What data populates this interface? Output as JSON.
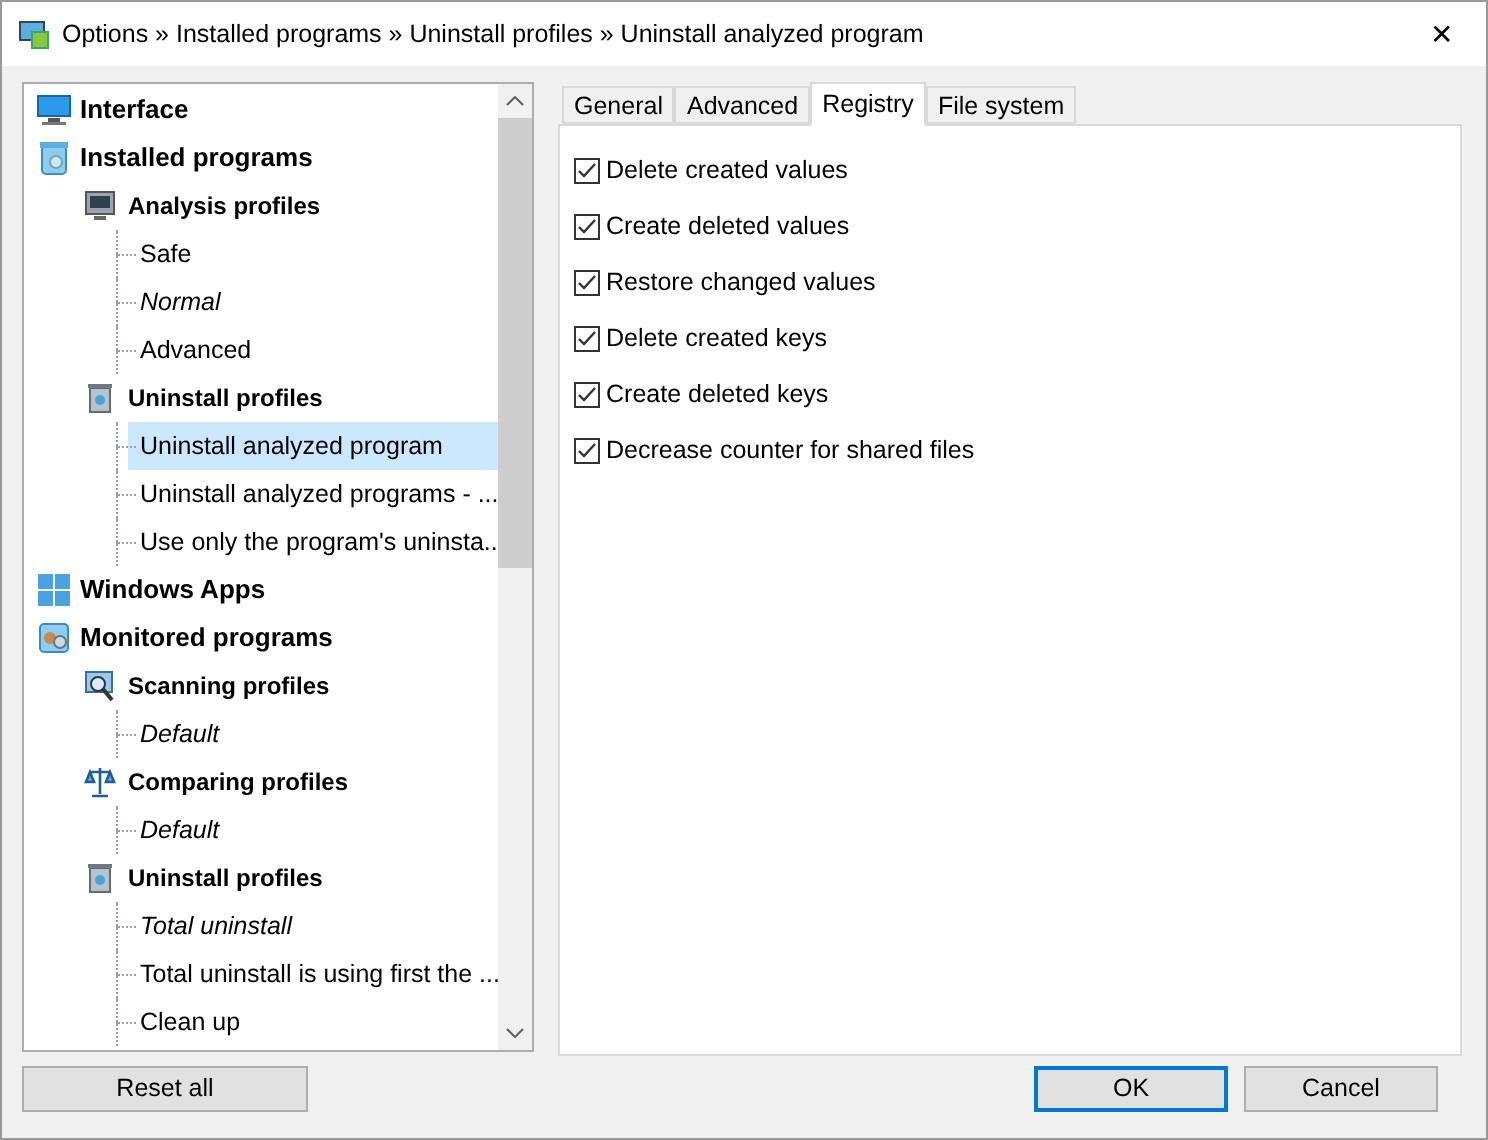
{
  "window": {
    "title": "Options » Installed programs » Uninstall profiles » Uninstall analyzed program",
    "close": "✕"
  },
  "tree": [
    {
      "label": "Interface",
      "kind": "monitor"
    },
    {
      "label": "Installed programs",
      "kind": "bin",
      "children": [
        {
          "label": "Analysis profiles",
          "kind": "screen",
          "children": [
            {
              "label": "Safe",
              "italic": false,
              "selected": false
            },
            {
              "label": "Normal",
              "italic": true,
              "selected": false
            },
            {
              "label": "Advanced",
              "italic": false,
              "selected": false
            }
          ]
        },
        {
          "label": "Uninstall profiles",
          "kind": "trash",
          "children": [
            {
              "label": "Uninstall analyzed program",
              "italic": false,
              "selected": true
            },
            {
              "label": "Uninstall analyzed programs - ...",
              "italic": false,
              "selected": false
            },
            {
              "label": "Use only the program's uninsta...",
              "italic": false,
              "selected": false
            }
          ]
        }
      ]
    },
    {
      "label": "Windows Apps",
      "kind": "tiles"
    },
    {
      "label": "Monitored programs",
      "kind": "monitored",
      "children": [
        {
          "label": "Scanning profiles",
          "kind": "magnifier",
          "children": [
            {
              "label": "Default",
              "italic": true,
              "selected": false
            }
          ]
        },
        {
          "label": "Comparing profiles",
          "kind": "scales",
          "children": [
            {
              "label": "Default",
              "italic": true,
              "selected": false
            }
          ]
        },
        {
          "label": "Uninstall profiles",
          "kind": "trash",
          "children": [
            {
              "label": "Total uninstall",
              "italic": true,
              "selected": false
            },
            {
              "label": "Total uninstall is using first the ...",
              "italic": false,
              "selected": false
            },
            {
              "label": "Clean up",
              "italic": false,
              "selected": false
            }
          ]
        }
      ]
    }
  ],
  "tabs": [
    {
      "label": "General",
      "selected": false
    },
    {
      "label": "Advanced",
      "selected": false
    },
    {
      "label": "Registry",
      "selected": true
    },
    {
      "label": "File system",
      "selected": false
    }
  ],
  "options": [
    {
      "label": "Delete created values",
      "checked": true
    },
    {
      "label": "Create deleted values",
      "checked": true
    },
    {
      "label": "Restore changed values",
      "checked": true
    },
    {
      "label": "Delete created keys",
      "checked": true
    },
    {
      "label": "Create deleted keys",
      "checked": true
    },
    {
      "label": "Decrease counter for shared files",
      "checked": true
    }
  ],
  "buttons": {
    "reset": "Reset all",
    "ok": "OK",
    "cancel": "Cancel"
  }
}
